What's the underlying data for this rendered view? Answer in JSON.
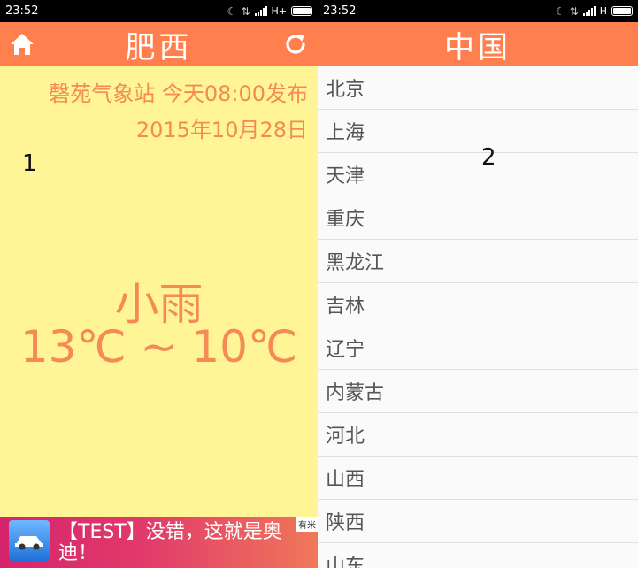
{
  "left_screen": {
    "status": {
      "time": "23:52",
      "network": "H+"
    },
    "title": "肥西",
    "station": "磬苑气象站 今天08:00发布",
    "date": "2015年10月28日",
    "marker": "1",
    "condition": "小雨",
    "temperature": "13℃ ~ 10℃",
    "ad": {
      "text": "【TEST】没错，这就是奥迪！",
      "badge": "有米"
    }
  },
  "right_screen": {
    "status": {
      "time": "23:52",
      "network": "H"
    },
    "title": "中国",
    "marker": "2",
    "cities": [
      "北京",
      "上海",
      "天津",
      "重庆",
      "黑龙江",
      "吉林",
      "辽宁",
      "内蒙古",
      "河北",
      "山西",
      "陕西",
      "山东"
    ]
  },
  "colors": {
    "accent": "#ff7f4f",
    "weather_bg": "#fff496",
    "weather_text": "#f48a55"
  },
  "icons": {
    "home": "home-icon",
    "refresh": "refresh-icon"
  }
}
